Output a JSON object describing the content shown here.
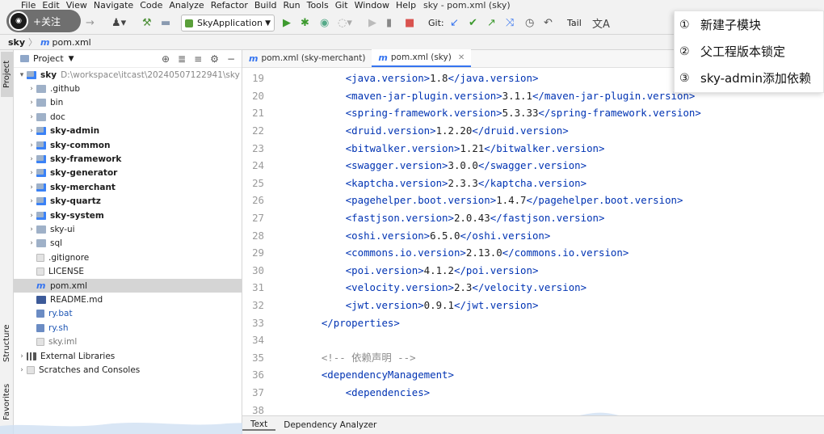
{
  "window": {
    "title": "sky - pom.xml (sky)",
    "menu": [
      "File",
      "Edit",
      "View",
      "Navigate",
      "Code",
      "Analyze",
      "Refactor",
      "Build",
      "Run",
      "Tools",
      "Git",
      "Window",
      "Help"
    ]
  },
  "overlay": {
    "follow_label": "+关注"
  },
  "toolbar": {
    "run_config": "SkyApplication",
    "git_label": "Git:",
    "tail_label": "Tail"
  },
  "breadcrumb": {
    "root": "sky",
    "file": "pom.xml"
  },
  "sidebar_tabs": {
    "project": "Project",
    "structure": "Structure",
    "favorites": "Favorites"
  },
  "project_panel": {
    "title": "Project",
    "root_name": "sky",
    "root_path": "D:\\workspace\\itcast\\20240507122941\\sky",
    "items": [
      {
        "name": ".github",
        "kind": "folder",
        "bold": false
      },
      {
        "name": "bin",
        "kind": "folder",
        "bold": false
      },
      {
        "name": "doc",
        "kind": "folder",
        "bold": false
      },
      {
        "name": "sky-admin",
        "kind": "module",
        "bold": true
      },
      {
        "name": "sky-common",
        "kind": "module",
        "bold": true
      },
      {
        "name": "sky-framework",
        "kind": "module",
        "bold": true
      },
      {
        "name": "sky-generator",
        "kind": "module",
        "bold": true
      },
      {
        "name": "sky-merchant",
        "kind": "module",
        "bold": true
      },
      {
        "name": "sky-quartz",
        "kind": "module",
        "bold": true
      },
      {
        "name": "sky-system",
        "kind": "module",
        "bold": true
      },
      {
        "name": "sky-ui",
        "kind": "folder",
        "bold": false
      },
      {
        "name": "sql",
        "kind": "folder",
        "bold": false
      },
      {
        "name": ".gitignore",
        "kind": "file",
        "bold": false
      },
      {
        "name": "LICENSE",
        "kind": "file",
        "bold": false
      },
      {
        "name": "pom.xml",
        "kind": "maven",
        "bold": false,
        "selected": true
      },
      {
        "name": "README.md",
        "kind": "md",
        "bold": false
      },
      {
        "name": "ry.bat",
        "kind": "bat",
        "bold": false
      },
      {
        "name": "ry.sh",
        "kind": "bat",
        "bold": false
      },
      {
        "name": "sky.iml",
        "kind": "iml",
        "bold": false
      }
    ],
    "external_libraries": "External Libraries",
    "scratches": "Scratches and Consoles"
  },
  "editor": {
    "tabs": [
      {
        "label": "pom.xml (sky-merchant)",
        "active": false
      },
      {
        "label": "pom.xml (sky)",
        "active": true
      }
    ],
    "lines": [
      {
        "n": "19",
        "indent": 2,
        "open": "<java.version>",
        "val": "1.8",
        "close": "</java.version>"
      },
      {
        "n": "20",
        "indent": 2,
        "open": "<maven-jar-plugin.version>",
        "val": "3.1.1",
        "close": "</maven-jar-plugin.version>"
      },
      {
        "n": "21",
        "indent": 2,
        "open": "<spring-framework.version>",
        "val": "5.3.33",
        "close": "</spring-framework.version>"
      },
      {
        "n": "22",
        "indent": 2,
        "open": "<druid.version>",
        "val": "1.2.20",
        "close": "</druid.version>"
      },
      {
        "n": "23",
        "indent": 2,
        "open": "<bitwalker.version>",
        "val": "1.21",
        "close": "</bitwalker.version>"
      },
      {
        "n": "24",
        "indent": 2,
        "open": "<swagger.version>",
        "val": "3.0.0",
        "close": "</swagger.version>"
      },
      {
        "n": "25",
        "indent": 2,
        "open": "<kaptcha.version>",
        "val": "2.3.3",
        "close": "</kaptcha.version>"
      },
      {
        "n": "26",
        "indent": 2,
        "open": "<pagehelper.boot.version>",
        "val": "1.4.7",
        "close": "</pagehelper.boot.version>"
      },
      {
        "n": "27",
        "indent": 2,
        "open": "<fastjson.version>",
        "val": "2.0.43",
        "close": "</fastjson.version>"
      },
      {
        "n": "28",
        "indent": 2,
        "open": "<oshi.version>",
        "val": "6.5.0",
        "close": "</oshi.version>"
      },
      {
        "n": "29",
        "indent": 2,
        "open": "<commons.io.version>",
        "val": "2.13.0",
        "close": "</commons.io.version>"
      },
      {
        "n": "30",
        "indent": 2,
        "open": "<poi.version>",
        "val": "4.1.2",
        "close": "</poi.version>"
      },
      {
        "n": "31",
        "indent": 2,
        "open": "<velocity.version>",
        "val": "2.3",
        "close": "</velocity.version>"
      },
      {
        "n": "32",
        "indent": 2,
        "open": "<jwt.version>",
        "val": "0.9.1",
        "close": "</jwt.version>"
      },
      {
        "n": "33",
        "indent": 1,
        "open": "</properties>",
        "val": "",
        "close": ""
      },
      {
        "n": "34",
        "indent": 0,
        "open": "",
        "val": "",
        "close": ""
      },
      {
        "n": "35",
        "indent": 1,
        "comment": "<!-- 依赖声明 -->"
      },
      {
        "n": "36",
        "indent": 1,
        "open": "<dependencyManagement>",
        "val": "",
        "close": ""
      },
      {
        "n": "37",
        "indent": 2,
        "open": "<dependencies>",
        "val": "",
        "close": ""
      },
      {
        "n": "38",
        "indent": 0,
        "open": "",
        "val": "",
        "close": ""
      }
    ]
  },
  "bottom_tabs": [
    "Text",
    "Dependency Analyzer"
  ],
  "popup_list": [
    {
      "num": "①",
      "text": "新建子模块"
    },
    {
      "num": "②",
      "text": "父工程版本锁定"
    },
    {
      "num": "③",
      "text": "sky-admin添加依赖"
    }
  ],
  "colors": {
    "accent": "#3574f0",
    "xml_tag": "#0033b3",
    "comment": "#8c8c8c"
  }
}
